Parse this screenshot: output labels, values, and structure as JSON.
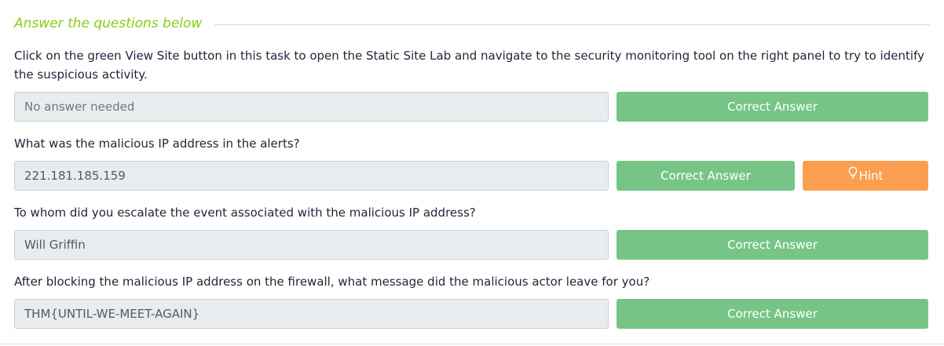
{
  "section": {
    "title": "Answer the questions below"
  },
  "questions": [
    {
      "text": "Click on the green View Site button in this task to open the Static Site Lab and navigate to the security monitoring tool on the right panel to try to identify the suspicious activity.",
      "answer": "No answer needed",
      "button": "Correct Answer"
    },
    {
      "text": "What was the malicious IP address in the alerts?",
      "answer": "221.181.185.159",
      "button": "Correct Answer",
      "hint": "Hint"
    },
    {
      "text": "To whom did you escalate the event associated with the malicious IP address?",
      "answer": "Will Griffin",
      "button": "Correct Answer"
    },
    {
      "text": "After blocking the malicious IP address on the firewall, what message did the malicious actor leave for you?",
      "answer": "THM{UNTIL-WE-MEET-AGAIN}",
      "button": "Correct Answer"
    }
  ],
  "colors": {
    "accent_green_title": "#88cc14",
    "correct_button": "#77c586",
    "hint_button": "#fb9e50",
    "field_background": "#e9ecef",
    "text": "#1c2538"
  },
  "icons": {
    "hint": "lightbulb-icon"
  }
}
